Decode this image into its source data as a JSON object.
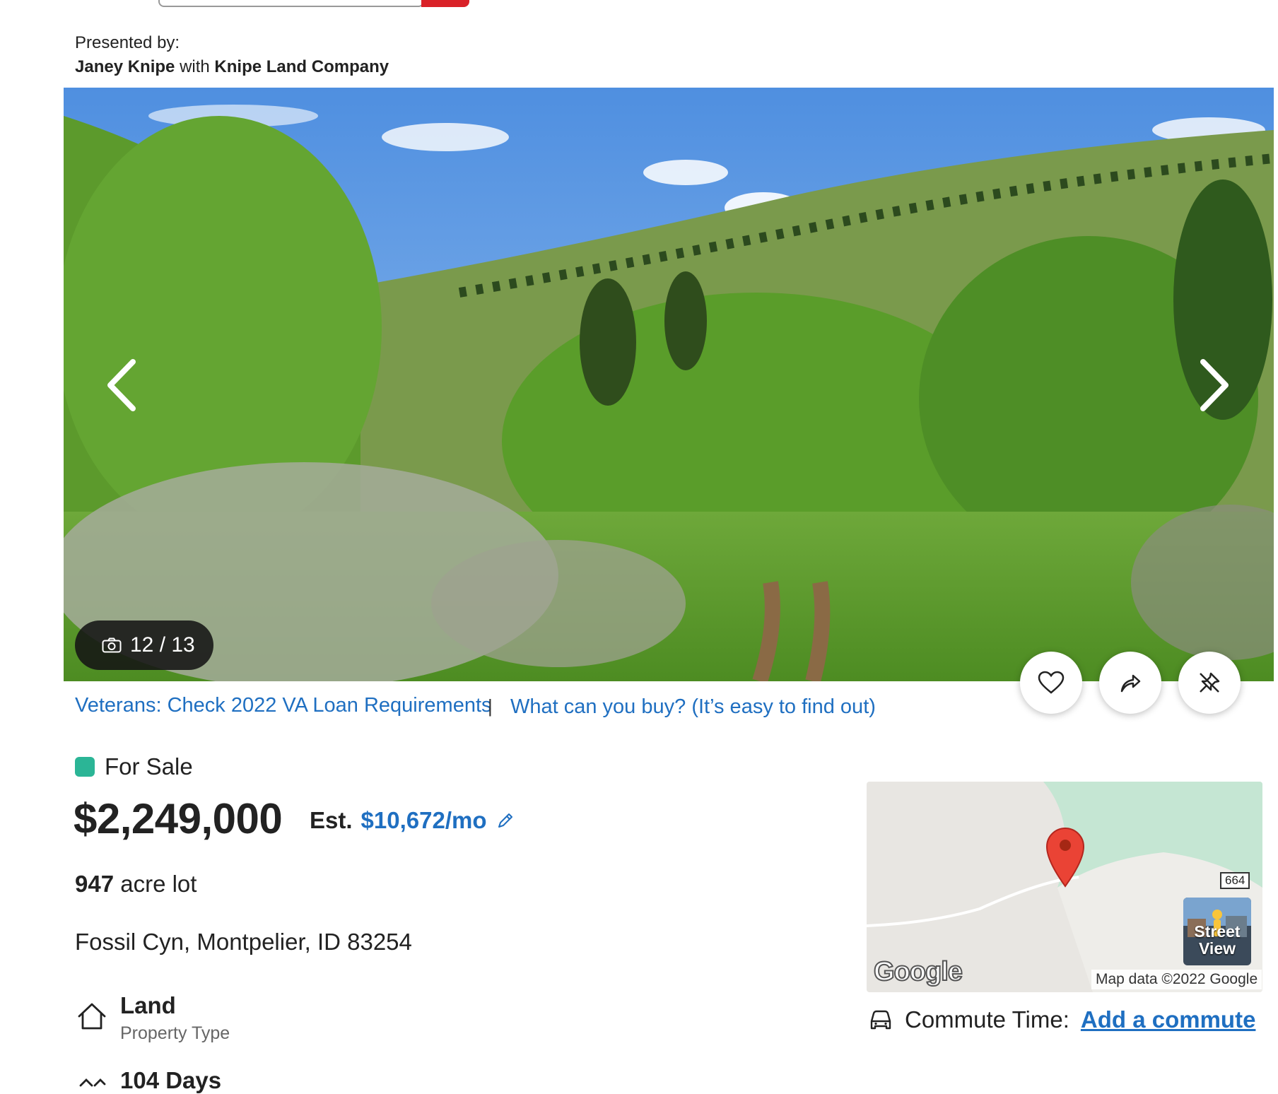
{
  "presented_by": {
    "label": "Presented by:",
    "agent": "Janey Knipe",
    "connector": "with",
    "company": "Knipe Land Company"
  },
  "gallery": {
    "counter": "12 / 13",
    "icons": {
      "prev": "chevron-left-icon",
      "next": "chevron-right-icon",
      "camera": "camera-icon",
      "favorite": "heart-icon",
      "share": "share-arrow-icon",
      "hide": "hide-pin-icon"
    }
  },
  "promos": {
    "va_loan": "Veterans: Check 2022 VA Loan Requirements",
    "separator": "|",
    "buy": "What can you buy? (It’s easy to find out)"
  },
  "listing": {
    "status": "For Sale",
    "status_color": "#2bb596",
    "price": "$2,249,000",
    "est_label": "Est.",
    "est_value": "$10,672/mo",
    "lot_size": "947",
    "lot_unit": "acre lot",
    "address": "Fossil Cyn, Montpelier, ID 83254",
    "property_type_value": "Land",
    "property_type_label": "Property Type",
    "days_value": "104 Days"
  },
  "map": {
    "attribution": "Map data ©2022 Google",
    "logo": "Google",
    "road_shield": "664",
    "street_view_label": "Street View"
  },
  "commute": {
    "label": "Commute Time:",
    "link": "Add a commute"
  },
  "colors": {
    "link": "#1f6fc1",
    "brand_red": "#d92228"
  }
}
